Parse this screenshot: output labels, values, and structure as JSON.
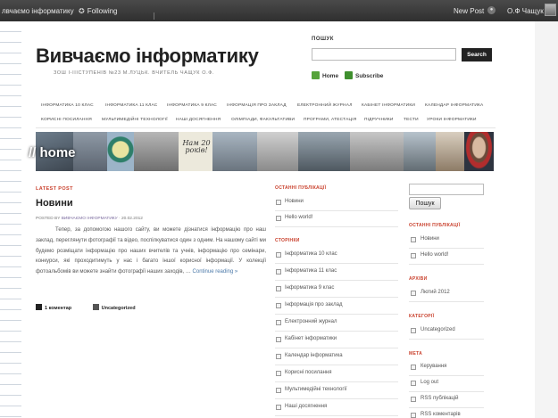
{
  "adminbar": {
    "site_label": "лвчаємо інформатику",
    "following_label": "Following",
    "new_post_label": "New Post",
    "user_label": "О.Ф Чащук"
  },
  "site": {
    "title": "Вивчаємо інформатику",
    "description": "ЗОШ І-ІІІСТУПЕНІВ №23 М.ЛУЦЬК. ВЧИТЕЛЬ ЧАЩУК О.Ф."
  },
  "search": {
    "label": "ПОШУК",
    "button_label": "Search",
    "home_label": "Home",
    "subscribe_label": "Subscribe"
  },
  "nav": {
    "row1": [
      "ІНФОРМАТИКА 10 КЛАС",
      "ІНФОРМАТИКА 11 КЛАС",
      "ІНФОРМАТИКА 9 КЛАС",
      "ІНФОРМАЦІЯ ПРО ЗАКЛАД",
      "ЕЛЕКТРОННИЙ ЖУРНАЛ",
      "КАБІНЕТ ІНФОРМАТИКИ",
      "КАЛЕНДАР ІНФОРМАТИКА"
    ],
    "row2": [
      "КОРИСНІ ПОСИЛАННЯ",
      "МУЛЬТИМЕДІЙНІ ТЕХНОЛОГІЇ",
      "НАШІ ДОСЯГНЕННЯ",
      "ОЛІМПІАДИ, ФАКУЛЬТАТИВИ",
      "ПРОГРАМИ, АТЕСТАЦІЯ",
      "ПІДРУЧНИКИ",
      "ТЕСТИ",
      "УРОКИ ІНФОРМАТИКИ"
    ]
  },
  "banner": {
    "label": "// home",
    "poster_text": "Нам 20 років!"
  },
  "latest": {
    "section_label": "LATEST POST",
    "title": "Новини",
    "meta_prefix": "POSTED BY",
    "meta_author": "ВИВЧАЄМО ІНФОРМАТИКУ",
    "meta_date": "· 20.02.2012",
    "body": "Тепер, за допомогою нашого сайту, ви можете дізнатися інформацію про наш заклад, переглянути фотографії та відео, поспілкуватися один з одним. На нашому сайті ми будемо розміщати інформацію про наших вчителів та учнів, інформацію про семінари, конкурси, які проходитимуть у нас і багато іншої корисної інформації. У колекції фотоальбомів ви можете знайти фотографії наших заходів, …",
    "more_label": "Continue reading »",
    "comments_label": "1 коментар",
    "category_label": "Uncategorized"
  },
  "middle": {
    "recent_title": "ОСТАННІ ПУБЛІКАЦІЇ",
    "recent": [
      "Новини",
      "Hello world!"
    ],
    "pages_title": "СТОРІНКИ",
    "pages": [
      "Інформатика 10 клас",
      "Інформатика 11 клас",
      "Інформатика 9 клас",
      "Інформація про заклад",
      "Електронний журнал",
      "Кабінет інформатики",
      "Календар інформатика",
      "Корисні посилання",
      "Мультимедійні технології",
      "Наші досягнення"
    ]
  },
  "sidebar": {
    "search_button": "Пошук",
    "recent_title": "ОСТАННІ ПУБЛІКАЦІЇ",
    "recent": [
      "Новини",
      "Hello world!"
    ],
    "archive_title": "АРХІВИ",
    "archive": [
      "Лютий 2012"
    ],
    "categories_title": "КАТЕГОРІЇ",
    "categories": [
      "Uncategorized"
    ],
    "meta_title": "МЕТА",
    "meta": [
      "Керування",
      "Log out",
      "RSS публікацій",
      "RSS коментарів"
    ]
  },
  "colors": {
    "accent_red": "#c9402c",
    "adminbar": "#3a3a3a",
    "button_dark": "#222222",
    "subscribe_green": "#56a33a"
  }
}
